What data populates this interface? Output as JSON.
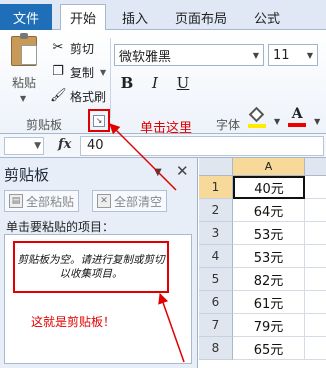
{
  "tabs": {
    "file": "文件",
    "items": [
      {
        "label": "开始",
        "active": true
      },
      {
        "label": "插入",
        "active": false
      },
      {
        "label": "页面布局",
        "active": false
      },
      {
        "label": "公式",
        "active": false
      }
    ]
  },
  "ribbon": {
    "paste_label": "粘贴",
    "cut_label": "剪切",
    "copy_label": "复制",
    "format_painter_label": "格式刷",
    "font_name": "微软雅黑",
    "font_size": "11",
    "bold": "B",
    "italic": "I",
    "underline": "U",
    "font_color_letter": "A",
    "clipboard_group_label": "剪贴板",
    "font_group_label": "字体",
    "annotation_click_here": "单击这里",
    "colors": {
      "fill": "#ffeb00",
      "font": "#e00000",
      "annotation": "#e00000"
    }
  },
  "formula_bar": {
    "fx": "fx",
    "value": "40"
  },
  "clipboard_pane": {
    "title": "剪贴板",
    "paste_all": "全部粘贴",
    "clear_all": "全部清空",
    "hint": "单击要粘贴的项目：",
    "empty_message": "剪贴板为空。请进行复制或剪切以收集项目。",
    "annotation": "这就是剪贴板！"
  },
  "sheet": {
    "column_header": "A",
    "rows": [
      {
        "num": "1",
        "value": "40元",
        "selected": true
      },
      {
        "num": "2",
        "value": "64元",
        "selected": false
      },
      {
        "num": "3",
        "value": "53元",
        "selected": false
      },
      {
        "num": "4",
        "value": "53元",
        "selected": false
      },
      {
        "num": "5",
        "value": "82元",
        "selected": false
      },
      {
        "num": "6",
        "value": "61元",
        "selected": false
      },
      {
        "num": "7",
        "value": "79元",
        "selected": false
      },
      {
        "num": "8",
        "value": "65元",
        "selected": false
      }
    ]
  }
}
